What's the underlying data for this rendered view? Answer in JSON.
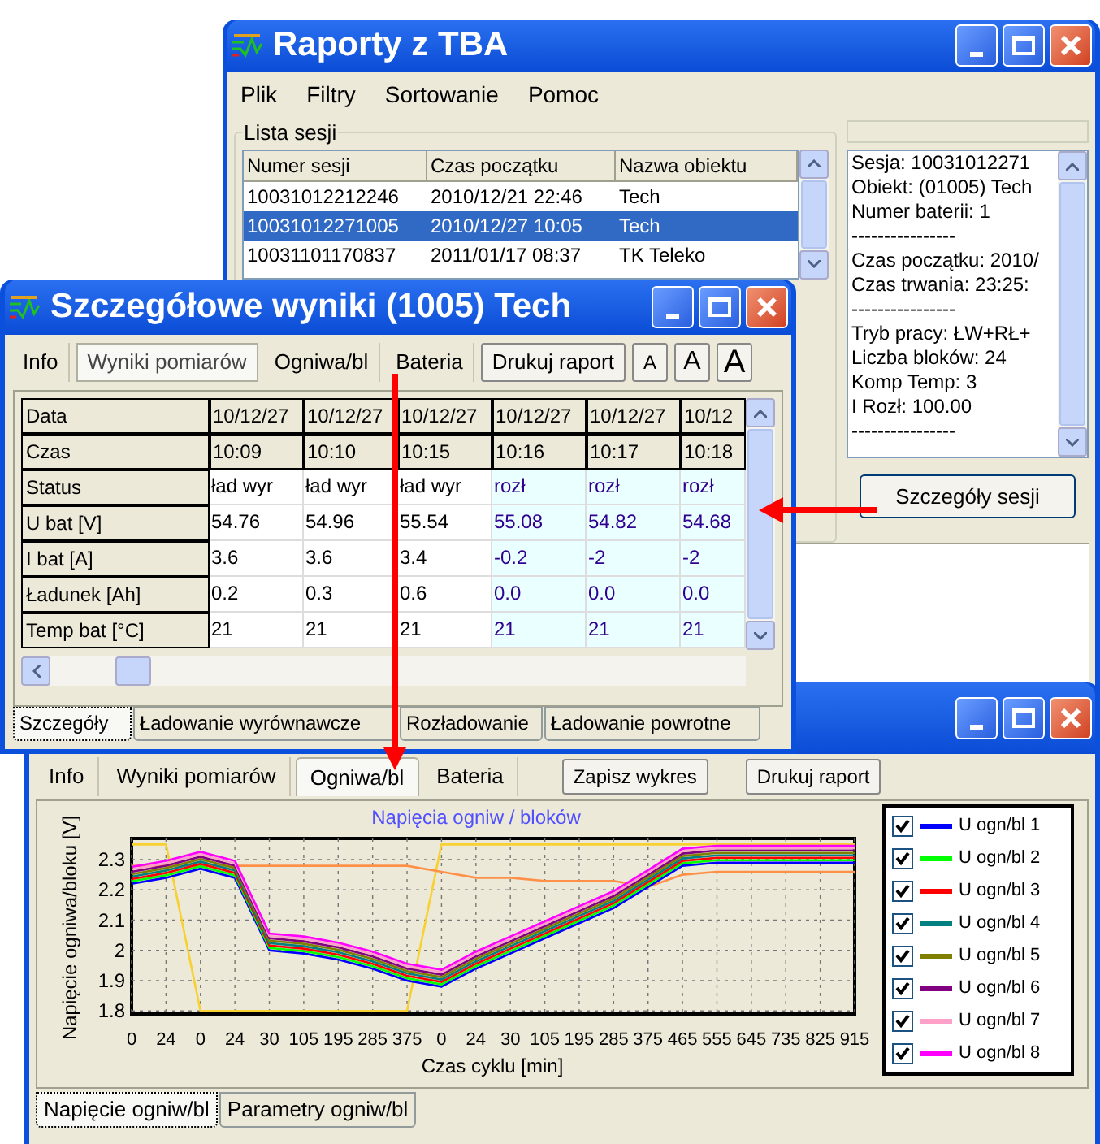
{
  "main_window": {
    "title": "Raporty z TBA",
    "menu": [
      "Plik",
      "Filtry",
      "Sortowanie",
      "Pomoc"
    ],
    "session_group": "Lista sesji",
    "sessions": {
      "columns": [
        "Numer sesji",
        "Czas początku",
        "Nazwa obiektu"
      ],
      "rows": [
        {
          "cells": [
            "10031012212246",
            "2010/12/21 22:46",
            "Tech"
          ],
          "selected": false
        },
        {
          "cells": [
            "10031012271005",
            "2010/12/27 10:05",
            "Tech"
          ],
          "selected": true
        },
        {
          "cells": [
            "10031101170837",
            "2011/01/17 08:37",
            "TK Teleko"
          ],
          "selected": false
        }
      ]
    },
    "session_info": [
      "Sesja: 10031012271",
      "Obiekt: (01005) Tech",
      "Numer baterii: 1",
      "----------------",
      "Czas początku: 2010/",
      "Czas trwania: 23:25:",
      "----------------",
      "Tryb pracy: ŁW+RŁ+",
      "Liczba bloków: 24",
      "Komp Temp: 3",
      "I Rozł: 100.00",
      "----------------"
    ],
    "details_button": "Szczegóły sesji"
  },
  "details_window": {
    "title": "Szczegółowe wyniki (1005) Tech",
    "tabs": [
      {
        "label": "Info",
        "selected": false
      },
      {
        "label": "Wyniki pomiarów",
        "selected": true
      },
      {
        "label": "Ogniwa/bl",
        "selected": false
      },
      {
        "label": "Bateria",
        "selected": false
      }
    ],
    "print_button": "Drukuj raport",
    "font_buttons": [
      "A",
      "A",
      "A"
    ],
    "table": {
      "columns": [
        {
          "kind": "charge"
        },
        {
          "kind": "charge"
        },
        {
          "kind": "charge"
        },
        {
          "kind": "discharge"
        },
        {
          "kind": "discharge"
        },
        {
          "kind": "discharge"
        }
      ],
      "rows": [
        {
          "label": "Data",
          "kind": "header",
          "cells": [
            "10/12/27",
            "10/12/27",
            "10/12/27",
            "10/12/27",
            "10/12/27",
            "10/12"
          ]
        },
        {
          "label": "Czas",
          "kind": "header",
          "cells": [
            "10:09",
            "10:10",
            "10:15",
            "10:16",
            "10:17",
            "10:18"
          ]
        },
        {
          "label": "Status",
          "kind": "data",
          "cells": [
            "ład wyr",
            "ład wyr",
            "ład wyr",
            "rozł",
            "rozł",
            "rozł"
          ]
        },
        {
          "label": "U bat [V]",
          "kind": "data",
          "cells": [
            "54.76",
            "54.96",
            "55.54",
            "55.08",
            "54.82",
            "54.68"
          ]
        },
        {
          "label": "I bat [A]",
          "kind": "data",
          "cells": [
            "3.6",
            "3.6",
            "3.4",
            "-0.2",
            "-2",
            "-2"
          ]
        },
        {
          "label": "Ładunek [Ah]",
          "kind": "data",
          "cells": [
            "0.2",
            "0.3",
            "0.6",
            "0.0",
            "0.0",
            "0.0"
          ]
        },
        {
          "label": "Temp bat [°C]",
          "kind": "data",
          "cells": [
            "21",
            "21",
            "21",
            "21",
            "21",
            "21"
          ]
        }
      ]
    },
    "bottom_tabs": [
      {
        "label": "Szczegóły",
        "selected": true
      },
      {
        "label": "Ładowanie wyrównawcze",
        "selected": false
      },
      {
        "label": "Rozładowanie",
        "selected": false
      },
      {
        "label": "Ładowanie powrotne",
        "selected": false
      }
    ]
  },
  "chart_window": {
    "tabs": [
      {
        "label": "Info",
        "selected": false
      },
      {
        "label": "Wyniki pomiarów",
        "selected": false
      },
      {
        "label": "Ogniwa/bl",
        "selected": true
      },
      {
        "label": "Bateria",
        "selected": false
      }
    ],
    "buttons": [
      "Zapisz wykres",
      "Drukuj raport"
    ],
    "chart_data": {
      "type": "line",
      "title": "Napięcia ogniw / bloków",
      "xlabel": "Czas cyklu [min]",
      "ylabel": "Napięcie ogniwa/bloku [V]",
      "categories": [
        "0",
        "24",
        "0",
        "24",
        "30",
        "105",
        "195",
        "285",
        "375",
        "0",
        "24",
        "30",
        "105",
        "195",
        "285",
        "375",
        "465",
        "555",
        "645",
        "735",
        "825",
        "915"
      ],
      "ylim": [
        1.79,
        2.37
      ],
      "grid": true,
      "yticks": [
        {
          "value": 1.8,
          "label": "1.8"
        },
        {
          "value": 1.9,
          "label": "1.9"
        },
        {
          "value": 2,
          "label": "2"
        },
        {
          "value": 2.1,
          "label": "2.1"
        },
        {
          "value": 2.2,
          "label": "2.2"
        },
        {
          "value": 2.3,
          "label": "2.3"
        }
      ],
      "series": [
        {
          "color": "#f8d030",
          "values": [
            2.35,
            2.35,
            1.8,
            1.8,
            1.8,
            1.8,
            1.8,
            1.8,
            1.8,
            2.35,
            2.35,
            2.35,
            2.35,
            2.35,
            2.35,
            2.35,
            2.35,
            2.35,
            2.35,
            2.35,
            2.35,
            2.35
          ]
        },
        {
          "color": "#ff9048",
          "values": [
            2.28,
            2.28,
            2.28,
            2.28,
            2.28,
            2.28,
            2.28,
            2.28,
            2.28,
            2.26,
            2.24,
            2.24,
            2.23,
            2.23,
            2.23,
            2.21,
            2.25,
            2.26,
            2.26,
            2.26,
            2.26,
            2.26
          ]
        },
        {
          "name": "U ogn/bl 1",
          "color": "#0000ff",
          "values": [
            2.22,
            2.24,
            2.27,
            2.24,
            2.0,
            1.99,
            1.97,
            1.94,
            1.9,
            1.88,
            1.94,
            1.99,
            2.04,
            2.09,
            2.14,
            2.21,
            2.28,
            2.29,
            2.29,
            2.29,
            2.29,
            2.29
          ]
        },
        {
          "name": "U ogn/bl 2",
          "color": "#00ff00",
          "values": [
            2.228,
            2.248,
            2.278,
            2.248,
            2.008,
            1.998,
            1.978,
            1.948,
            1.908,
            1.888,
            1.948,
            1.998,
            2.048,
            2.098,
            2.148,
            2.218,
            2.288,
            2.298,
            2.298,
            2.298,
            2.298,
            2.298
          ]
        },
        {
          "name": "U ogn/bl 3",
          "color": "#ff0000",
          "values": [
            2.236,
            2.256,
            2.286,
            2.256,
            2.016,
            2.006,
            1.986,
            1.956,
            1.916,
            1.896,
            1.956,
            2.006,
            2.056,
            2.106,
            2.156,
            2.226,
            2.296,
            2.306,
            2.306,
            2.306,
            2.306,
            2.306
          ]
        },
        {
          "name": "U ogn/bl 4",
          "color": "#008080",
          "values": [
            2.244,
            2.264,
            2.294,
            2.264,
            2.024,
            2.014,
            1.994,
            1.964,
            1.924,
            1.904,
            1.964,
            2.014,
            2.064,
            2.114,
            2.164,
            2.234,
            2.304,
            2.314,
            2.314,
            2.314,
            2.314,
            2.314
          ]
        },
        {
          "name": "U ogn/bl 5",
          "color": "#808000",
          "values": [
            2.252,
            2.272,
            2.302,
            2.272,
            2.032,
            2.022,
            2.002,
            1.972,
            1.932,
            1.912,
            1.972,
            2.022,
            2.072,
            2.122,
            2.172,
            2.242,
            2.312,
            2.322,
            2.322,
            2.322,
            2.322,
            2.322
          ]
        },
        {
          "name": "U ogn/bl 6",
          "color": "#800080",
          "values": [
            2.26,
            2.28,
            2.31,
            2.28,
            2.04,
            2.03,
            2.01,
            1.98,
            1.94,
            1.92,
            1.98,
            2.03,
            2.08,
            2.13,
            2.18,
            2.25,
            2.32,
            2.33,
            2.33,
            2.33,
            2.33,
            2.33
          ]
        },
        {
          "name": "U ogn/bl 7",
          "color": "#ffa0c8",
          "values": [
            2.268,
            2.288,
            2.318,
            2.288,
            2.048,
            2.038,
            2.018,
            1.988,
            1.948,
            1.928,
            1.988,
            2.038,
            2.088,
            2.138,
            2.188,
            2.258,
            2.328,
            2.338,
            2.338,
            2.338,
            2.338,
            2.338
          ]
        },
        {
          "name": "U ogn/bl 8",
          "color": "#ff00ff",
          "values": [
            2.276,
            2.296,
            2.326,
            2.296,
            2.056,
            2.046,
            2.026,
            1.996,
            1.956,
            1.936,
            1.996,
            2.046,
            2.096,
            2.146,
            2.196,
            2.266,
            2.336,
            2.346,
            2.346,
            2.346,
            2.346,
            2.346
          ]
        }
      ]
    },
    "legend": [
      {
        "checked": true
      },
      {
        "checked": true
      },
      {
        "checked": true
      },
      {
        "checked": true
      },
      {
        "checked": true
      },
      {
        "checked": true
      },
      {
        "checked": true
      },
      {
        "checked": true
      }
    ],
    "bottom_tabs": [
      {
        "label": "Napięcie ogniw/bl",
        "selected": true
      },
      {
        "label": "Parametry ogniw/bl",
        "selected": false
      }
    ]
  }
}
